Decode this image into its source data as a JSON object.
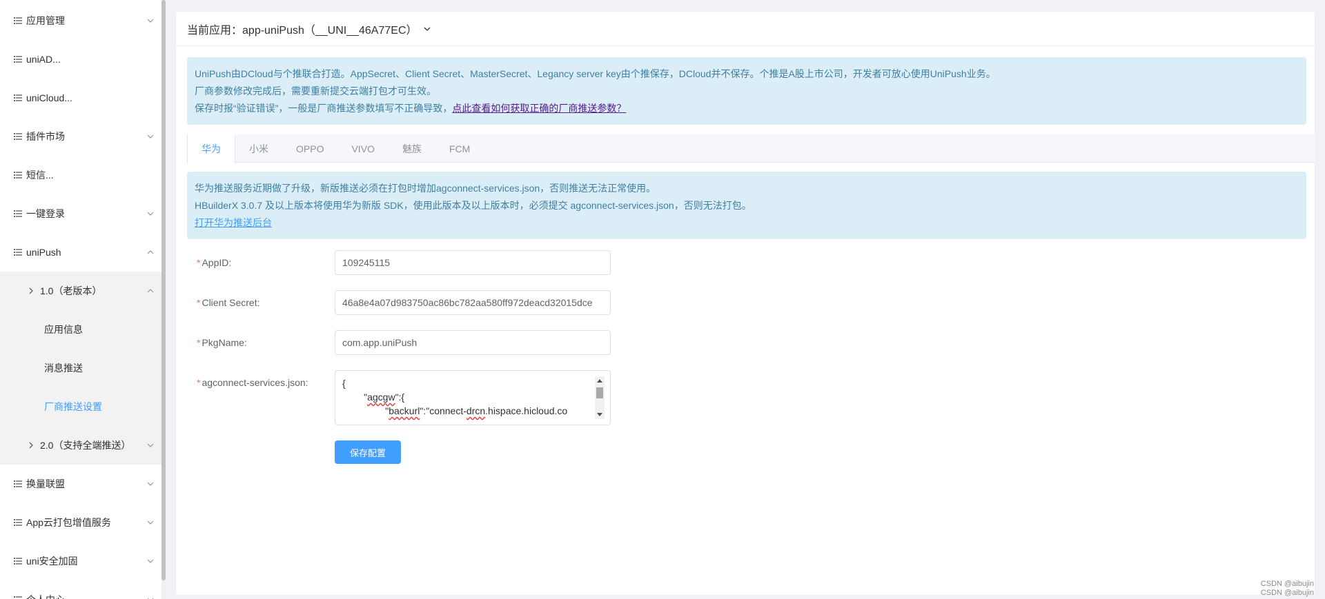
{
  "sidebar": {
    "items": [
      {
        "label": "应用管理",
        "has_arrow": true
      },
      {
        "label": "uniAD...",
        "has_arrow": false
      },
      {
        "label": "uniCloud...",
        "has_arrow": false
      },
      {
        "label": "插件市场",
        "has_arrow": true
      },
      {
        "label": "短信...",
        "has_arrow": false
      },
      {
        "label": "一键登录",
        "has_arrow": true
      },
      {
        "label": "uniPush",
        "has_arrow": true,
        "expanded": true
      },
      {
        "label": "换量联盟",
        "has_arrow": true
      },
      {
        "label": "App云打包增值服务",
        "has_arrow": true
      },
      {
        "label": "uni安全加固",
        "has_arrow": true
      },
      {
        "label": "个人中心",
        "has_arrow": true
      }
    ],
    "unipush_sub": {
      "v1_label": "1.0（老版本）",
      "v1_children": [
        "应用信息",
        "消息推送",
        "厂商推送设置"
      ],
      "active_child": "厂商推送设置",
      "v2_label": "2.0（支持全端推送）"
    }
  },
  "header": {
    "prefix": "当前应用：",
    "app_name": "app-uniPush（__UNI__46A77EC）"
  },
  "notice": {
    "line1": "UniPush由DCloud与个推联合打造。AppSecret、Client Secret、MasterSecret、Legancy server key由个推保存，DCloud并不保存。个推是A股上市公司，开发者可放心使用UniPush业务。",
    "line2": "厂商参数修改完成后，需要重新提交云端打包才可生效。",
    "line3_prefix": "保存时报“验证错误”，一般是厂商推送参数填写不正确导致，",
    "line3_link": "点此查看如何获取正确的厂商推送参数？"
  },
  "tabs": [
    {
      "label": "华为",
      "active": true
    },
    {
      "label": "小米",
      "active": false
    },
    {
      "label": "OPPO",
      "active": false
    },
    {
      "label": "VIVO",
      "active": false
    },
    {
      "label": "魅族",
      "active": false
    },
    {
      "label": "FCM",
      "active": false
    }
  ],
  "huawei_notice": {
    "line1": "华为推送服务近期做了升级，新版推送必须在打包时增加agconnect-services.json，否则推送无法正常使用。",
    "line2": "HBuilderX 3.0.7 及以上版本将使用华为新版 SDK，使用此版本及以上版本时，必须提交 agconnect-services.json，否则无法打包。",
    "link": "打开华为推送后台"
  },
  "form": {
    "appid_label": "AppID:",
    "appid_value": "109245115",
    "secret_label": "Client Secret:",
    "secret_value": "46a8e4a07d983750ac86bc782aa580ff972deacd32015dce",
    "pkg_label": "PkgName:",
    "pkg_value": "com.app.uniPush",
    "json_label": "agconnect-services.json:",
    "json_line1": "{",
    "json_line2_key": "agcgw",
    "json_line3_key": "backurl",
    "json_line3_val": "connect-drcn.hispace.hicloud.co",
    "json_line3_val_under": "drcn"
  },
  "save_label": "保存配置",
  "watermark": [
    "CSDN @aibujin",
    "CSDN @aibujin"
  ],
  "colors": {
    "accent": "#409eff",
    "alert_bg": "#dbeef7",
    "alert_text": "#3f7fa3",
    "required": "#f56c6c"
  }
}
